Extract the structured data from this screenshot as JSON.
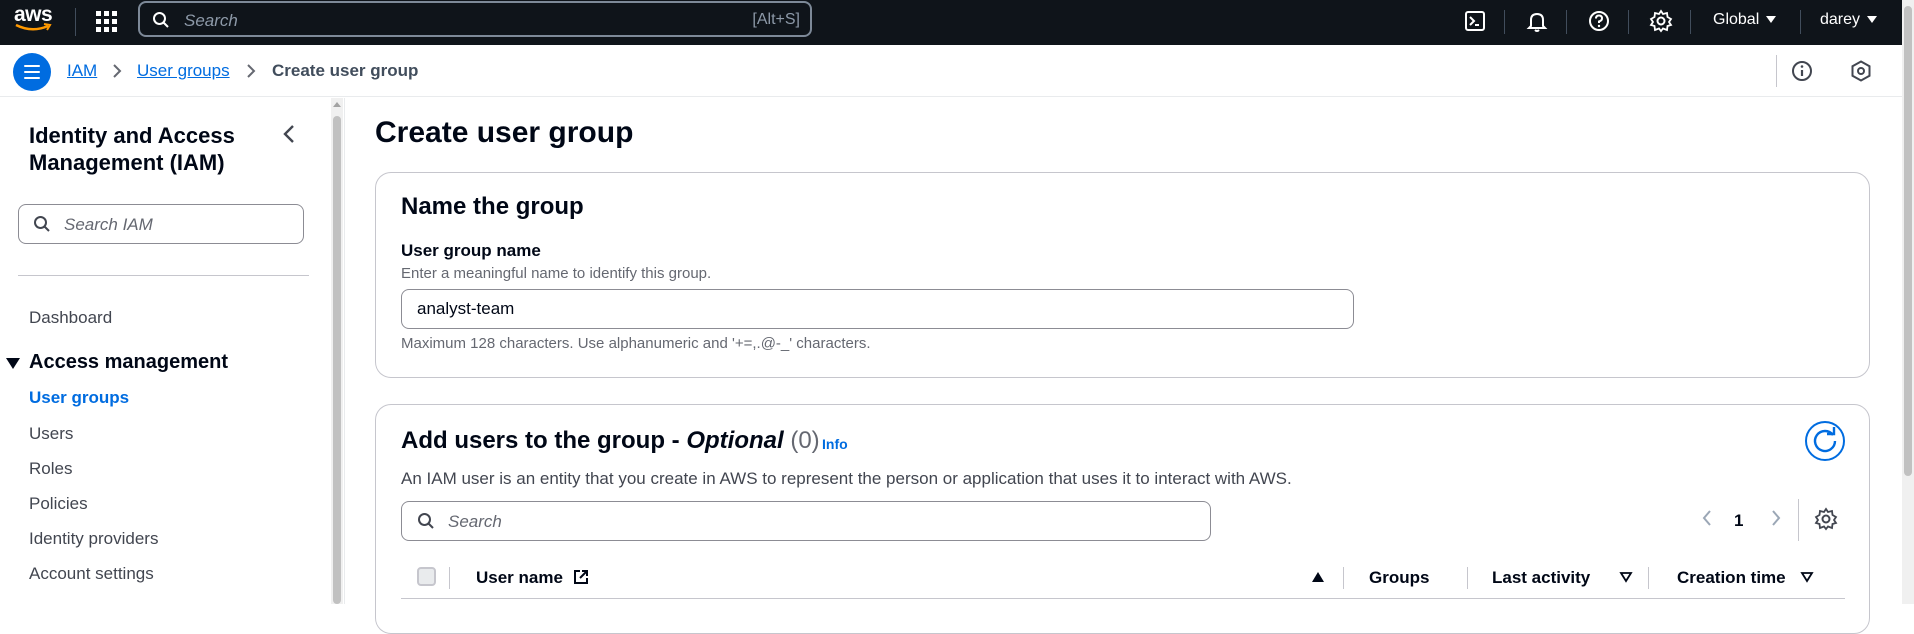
{
  "topnav": {
    "logo": "aws",
    "search_placeholder": "Search",
    "search_shortcut": "[Alt+S]",
    "region": "Global",
    "user": "darey",
    "icons": [
      "cloudshell-icon",
      "bell-icon",
      "help-icon",
      "settings-icon"
    ]
  },
  "breadcrumb": {
    "items": [
      {
        "label": "IAM",
        "link": true
      },
      {
        "label": "User groups",
        "link": true
      },
      {
        "label": "Create user group",
        "link": false
      }
    ]
  },
  "sidebar": {
    "title": "Identity and Access Management (IAM)",
    "search_placeholder": "Search IAM",
    "dashboard": "Dashboard",
    "section": "Access management",
    "items": [
      {
        "label": "User groups",
        "active": true
      },
      {
        "label": "Users",
        "active": false
      },
      {
        "label": "Roles",
        "active": false
      },
      {
        "label": "Policies",
        "active": false
      },
      {
        "label": "Identity providers",
        "active": false
      },
      {
        "label": "Account settings",
        "active": false
      }
    ]
  },
  "main": {
    "title": "Create user group",
    "name_card": {
      "heading": "Name the group",
      "label": "User group name",
      "description": "Enter a meaningful name to identify this group.",
      "value": "analyst-team",
      "constraint": "Maximum 128 characters. Use alphanumeric and '+=,.@-_' characters."
    },
    "users_card": {
      "heading_prefix": "Add users to the group - ",
      "heading_optional": "Optional",
      "count": "(0)",
      "info": "Info",
      "description": "An IAM user is an entity that you create in AWS to represent the person or application that uses it to interact with AWS.",
      "search_placeholder": "Search",
      "page": "1",
      "columns": [
        "User name",
        "Groups",
        "Last activity",
        "Creation time"
      ]
    }
  },
  "colors": {
    "nav_bg": "#0f141a",
    "accent": "#006ce0",
    "text": "#000716"
  }
}
